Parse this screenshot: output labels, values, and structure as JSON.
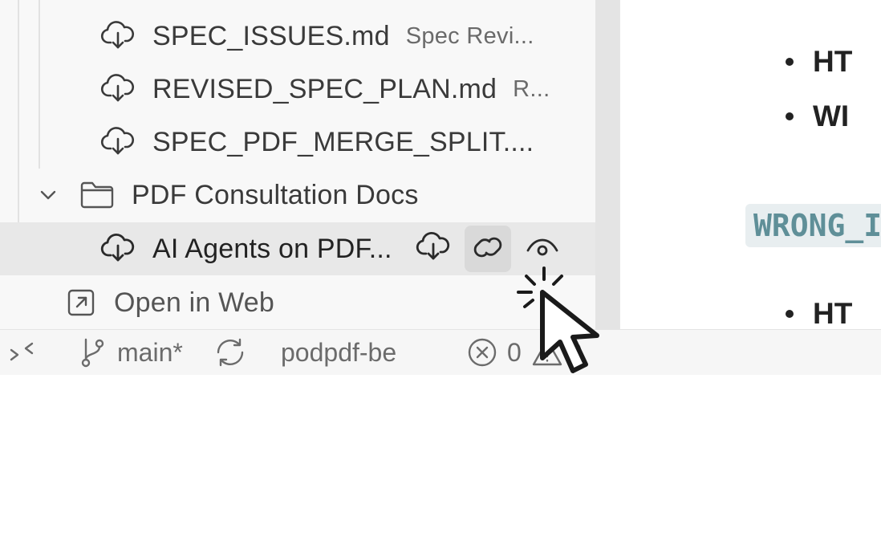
{
  "explorer": {
    "items": [
      {
        "name": "SPEC_ISSUES.md",
        "description": "Spec Revi...",
        "icon": "cloud-download-icon"
      },
      {
        "name": "REVISED_SPEC_PLAN.md",
        "description": "R...",
        "icon": "cloud-download-icon"
      },
      {
        "name": "SPEC_PDF_MERGE_SPLIT....",
        "description": "",
        "icon": "cloud-download-icon"
      }
    ],
    "folder": {
      "name": "PDF Consultation Docs",
      "icon": "folder-icon",
      "expanded": true
    },
    "selected_item": {
      "name": "AI Agents on PDF...",
      "icon": "cloud-download-icon",
      "actions": [
        "cloud-download-icon",
        "link-icon",
        "eye-icon"
      ]
    },
    "open_in_web": {
      "label": "Open in Web",
      "icon": "external-link-icon"
    }
  },
  "editor": {
    "bullets": [
      "HT",
      "WI",
      "HT"
    ],
    "code_text": "WRONG_I"
  },
  "statusbar": {
    "branch": "main*",
    "project": "podpdf-be",
    "errors": "0",
    "warnings": "0"
  },
  "colors": {
    "sidebar_bg": "#f8f8f8",
    "selected_bg": "#e8e8e8",
    "code_fg": "#5f8f98",
    "code_bg": "#e8eef0"
  }
}
